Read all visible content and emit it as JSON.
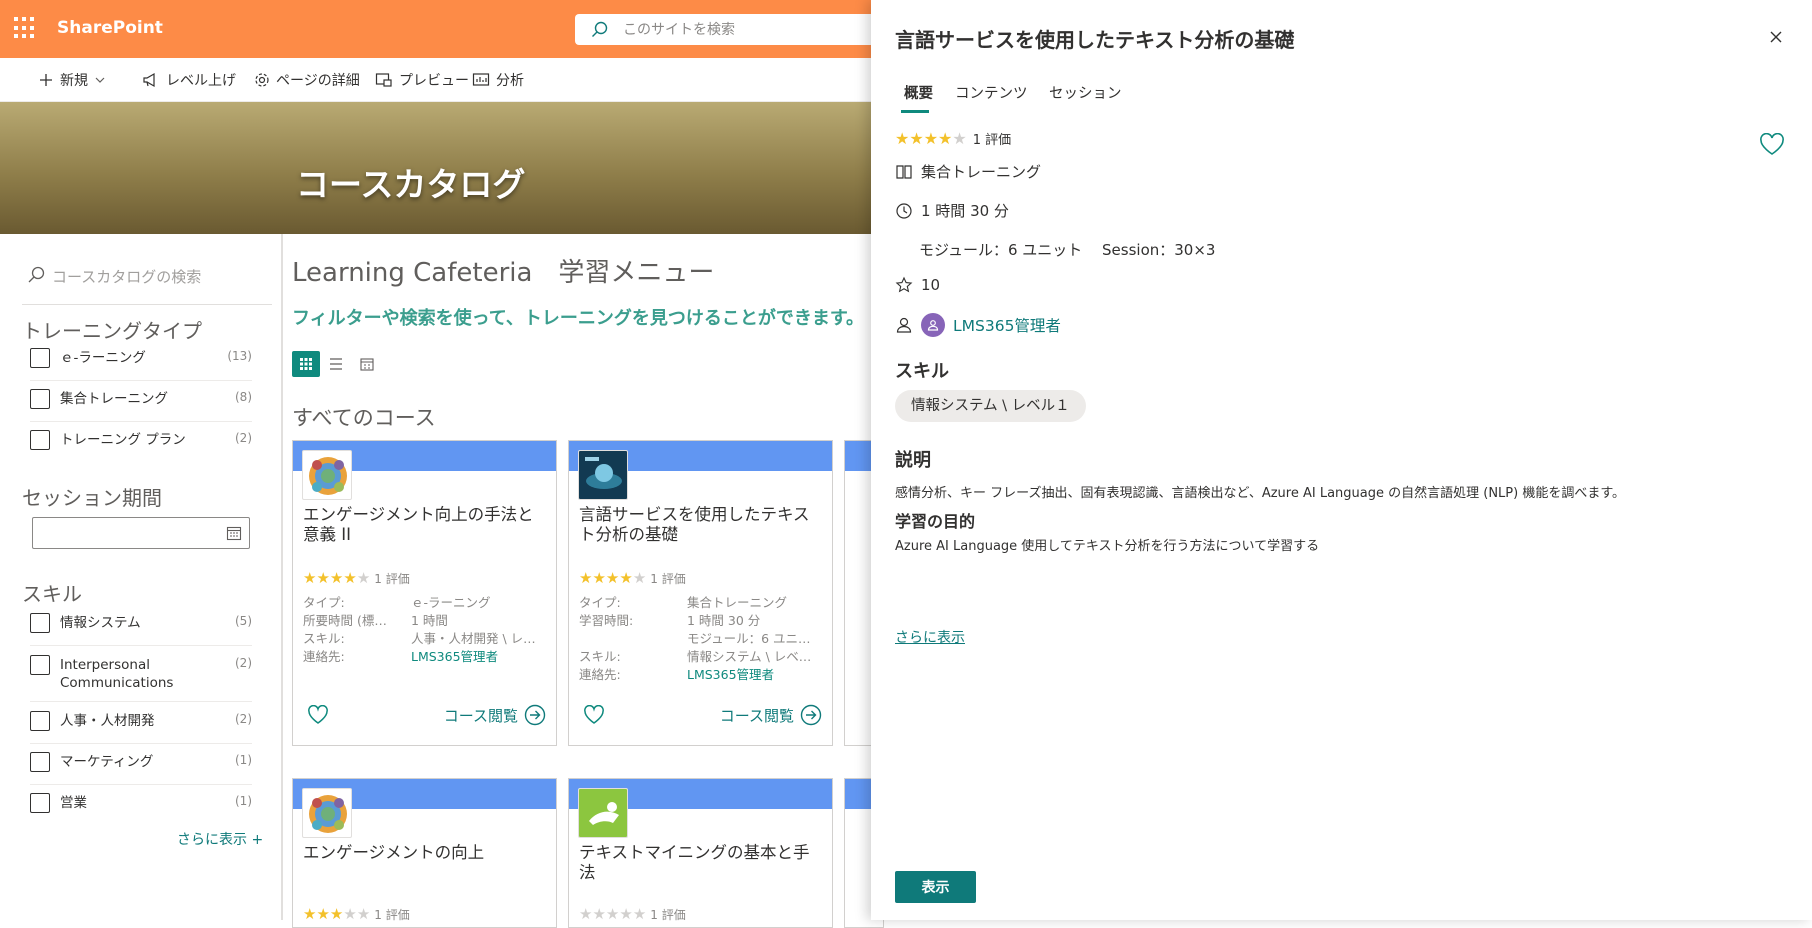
{
  "app": {
    "name": "SharePoint",
    "search_placeholder": "このサイトを検索"
  },
  "commands": [
    {
      "label": "新規",
      "icon": "plus-icon"
    },
    {
      "label": "レベル上げ",
      "icon": "megaphone-icon"
    },
    {
      "label": "ページの詳細",
      "icon": "gear-icon"
    },
    {
      "label": "プレビュー",
      "icon": "preview-icon"
    },
    {
      "label": "分析",
      "icon": "analytics-icon"
    }
  ],
  "hero": {
    "title": "コースカタログ"
  },
  "filters": {
    "search_placeholder": "コースカタログの検索",
    "training_type": {
      "title": "トレーニングタイプ",
      "items": [
        {
          "label": "ｅ-ラーニング",
          "count": "(13)"
        },
        {
          "label": "集合トレーニング",
          "count": "(8)"
        },
        {
          "label": "トレーニング プラン",
          "count": "(2)"
        }
      ]
    },
    "session_period": {
      "title": "セッション期間"
    },
    "skills": {
      "title": "スキル",
      "items": [
        {
          "label": "情報システム",
          "count": "(5)"
        },
        {
          "label": "Interpersonal Communications",
          "count": "(2)"
        },
        {
          "label": "人事・人材開発",
          "count": "(2)"
        },
        {
          "label": "マーケティング",
          "count": "(1)"
        },
        {
          "label": "営業",
          "count": "(1)"
        }
      ]
    },
    "more_label": "さらに表示 +"
  },
  "main": {
    "title": "Learning Cafeteria　学習メニュー",
    "subtitle": "フィルターや検索を使って、トレーニングを見つけることができます。",
    "section_title": "すべてのコース",
    "browse_label": "コース閲覧",
    "cards": [
      {
        "title": "エンゲージメント向上の手法と意義 II",
        "rating": 4,
        "rating_text": "1 評価",
        "meta": [
          {
            "k": "タイプ:",
            "v": "ｅ-ラーニング"
          },
          {
            "k": "所要時間 (標…",
            "v": "1 時間"
          },
          {
            "k": "スキル:",
            "v": "人事・人材開発 \\ レ…"
          },
          {
            "k": "連絡先:",
            "v": "LMS365管理者",
            "link": true
          }
        ]
      },
      {
        "title": "言語サービスを使用したテキスト分析の基礎",
        "rating": 4,
        "rating_text": "1 評価",
        "meta": [
          {
            "k": "タイプ:",
            "v": "集合トレーニング"
          },
          {
            "k": "学習時間:",
            "v": "1 時間 30 分"
          },
          {
            "k": "",
            "v": "モジュール：6 ユニ…"
          },
          {
            "k": "スキル:",
            "v": "情報システム \\ レベ…"
          },
          {
            "k": "連絡先:",
            "v": "LMS365管理者",
            "link": true
          }
        ]
      },
      {
        "title": "エンゲージメントの向上",
        "rating": 3,
        "rating_text": "1 評価"
      },
      {
        "title": "テキストマイニングの基本と手法",
        "rating": 0,
        "rating_text": "1 評価"
      }
    ]
  },
  "panel": {
    "title": "言語サービスを使用したテキスト分析の基礎",
    "tabs": [
      "概要",
      "コンテンツ",
      "セッション"
    ],
    "rating": 4,
    "rating_text": "1 評価",
    "training_type": "集合トレーニング",
    "duration": "1 時間 30 分",
    "modules": "モジュール：6 ユニット　 Session：30×3",
    "points": "10",
    "contact": "LMS365管理者",
    "skills_title": "スキル",
    "skill": "情報システム \\ レベル１",
    "desc_title": "説明",
    "description": "感情分析、キー フレーズ抽出、固有表現認識、言語検出など、Azure AI Language の自然言語処理 (NLP) 機能を調べます。",
    "goal_title": "学習の目的",
    "goal": "Azure AI Language 使用してテキスト分析を行う方法について学習する",
    "more_label": "さらに表示",
    "show_button": "表示"
  },
  "colors": {
    "suite": "#fd8b47",
    "accent": "#0f7a7a",
    "card_band": "#6196f2",
    "star": "#f3c12b"
  }
}
